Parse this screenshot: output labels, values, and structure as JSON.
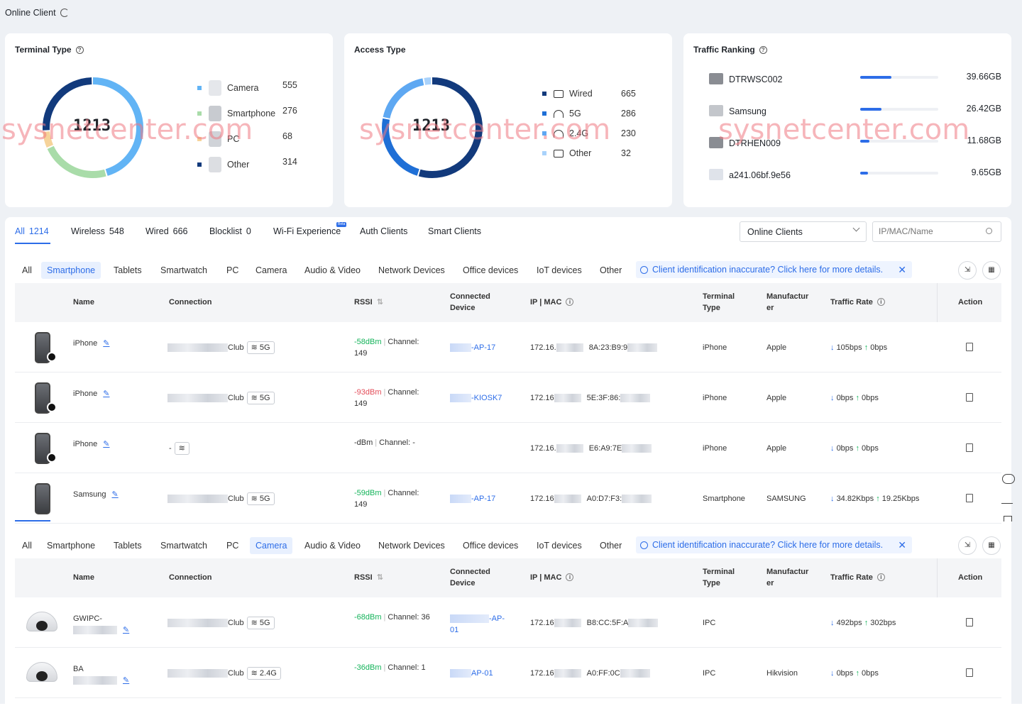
{
  "page": {
    "title": "Online Client"
  },
  "terminal_type": {
    "title": "Terminal Type",
    "total": "1213",
    "items": [
      {
        "label": "Camera",
        "value": "555",
        "color": "#62b4f5"
      },
      {
        "label": "Smartphone",
        "value": "276",
        "color": "#a9dca9"
      },
      {
        "label": "PC",
        "value": "68",
        "color": "#f6d39a"
      },
      {
        "label": "Other",
        "value": "314",
        "color": "#123a7c"
      }
    ]
  },
  "access_type": {
    "title": "Access Type",
    "total": "1213",
    "items": [
      {
        "label": "Wired",
        "value": "665",
        "color": "#123a7c"
      },
      {
        "label": "5G",
        "value": "286",
        "color": "#1f6fd6"
      },
      {
        "label": "2.4G",
        "value": "230",
        "color": "#5ea8f2"
      },
      {
        "label": "Other",
        "value": "32",
        "color": "#a9d2fb"
      }
    ]
  },
  "traffic_ranking": {
    "title": "Traffic Ranking",
    "items": [
      {
        "name": "DTRWSC002",
        "value": "39.66GB",
        "fraction": 0.4
      },
      {
        "name": "Samsung",
        "value": "26.42GB",
        "fraction": 0.27
      },
      {
        "name": "DTRHEN009",
        "value": "11.68GB",
        "fraction": 0.12
      },
      {
        "name": "a241.06bf.9e56",
        "value": "9.65GB",
        "fraction": 0.1
      }
    ]
  },
  "watermark": "sysnetcenter.com",
  "main_tabs": [
    {
      "label": "All",
      "count": "1214"
    },
    {
      "label": "Wireless",
      "count": "548"
    },
    {
      "label": "Wired",
      "count": "666"
    },
    {
      "label": "Blocklist",
      "count": "0"
    },
    {
      "label": "Wi-Fi Experience",
      "count": ""
    },
    {
      "label": "Auth Clients",
      "count": ""
    },
    {
      "label": "Smart Clients",
      "count": ""
    }
  ],
  "beta_badge": "Beta",
  "filter": {
    "selected": "Online Clients",
    "search_placeholder": "IP/MAC/Name"
  },
  "subtabs": [
    "All",
    "Smartphone",
    "Tablets",
    "Smartwatch",
    "PC",
    "Camera",
    "Audio & Video",
    "Network Devices",
    "Office devices",
    "IoT devices",
    "Other"
  ],
  "notice": "Client identification inaccurate? Click here for more details.",
  "columns": {
    "name": "Name",
    "connection": "Connection",
    "rssi": "RSSI",
    "connected_device_1": "Connected",
    "connected_device_2": "Device",
    "ipmac": "IP | MAC",
    "terminal_1": "Terminal",
    "terminal_2": "Type",
    "manuf_1": "Manufactur",
    "manuf_2": "er",
    "traffic": "Traffic Rate",
    "action": "Action"
  },
  "phone_rows": [
    {
      "name": "iPhone",
      "ssid_suffix": "Club",
      "band": "5G",
      "rssi": "-58dBm",
      "channel_1": "Channel:",
      "channel_2": "149",
      "device": "-AP-17",
      "ip": "172.16.",
      "mac": "8A:23:B9:9",
      "type": "iPhone",
      "manufacturer": "Apple",
      "down": "105bps",
      "up": "0bps"
    },
    {
      "name": "iPhone",
      "ssid_suffix": "Club",
      "band": "5G",
      "rssi": "-93dBm",
      "channel_1": "Channel:",
      "channel_2": "149",
      "device": "-KIOSK7",
      "ip": "172.16",
      "mac": "5E:3F:86:",
      "type": "iPhone",
      "manufacturer": "Apple",
      "down": "0bps",
      "up": "0bps"
    },
    {
      "name": "iPhone",
      "ssid_suffix": "-",
      "band": "",
      "rssi": "-dBm",
      "channel_1": "Channel: -",
      "channel_2": "",
      "device": "",
      "ip": "172.16.",
      "mac": "E6:A9:7E",
      "type": "iPhone",
      "manufacturer": "Apple",
      "down": "0bps",
      "up": "0bps"
    },
    {
      "name": "Samsung",
      "ssid_suffix": "Club",
      "band": "5G",
      "rssi": "-59dBm",
      "channel_1": "Channel:",
      "channel_2": "149",
      "device": "-AP-17",
      "ip": "172.16",
      "mac": "A0:D7:F3:",
      "type": "Smartphone",
      "manufacturer": "SAMSUNG",
      "down": "34.82Kbps",
      "up": "19.25Kbps"
    }
  ],
  "camera_rows": [
    {
      "name": "GWIPC-",
      "ssid_suffix": "Club",
      "band": "5G",
      "rssi": "-68dBm",
      "channel_1": "Channel: 36",
      "device": "-AP-",
      "device_2": "01",
      "ip": "172.16",
      "mac": "B8:CC:5F:A",
      "type": "IPC",
      "manufacturer": "",
      "down": "492bps",
      "up": "302bps"
    },
    {
      "name": "BA",
      "ssid_suffix": "Club",
      "band": "2.4G",
      "rssi": "-36dBm",
      "channel_1": "Channel: 1",
      "device": "AP-01",
      "device_2": "",
      "ip": "172.16",
      "mac": "A0:FF:0C",
      "type": "IPC",
      "manufacturer": "Hikvision",
      "down": "0bps",
      "up": "0bps"
    }
  ]
}
